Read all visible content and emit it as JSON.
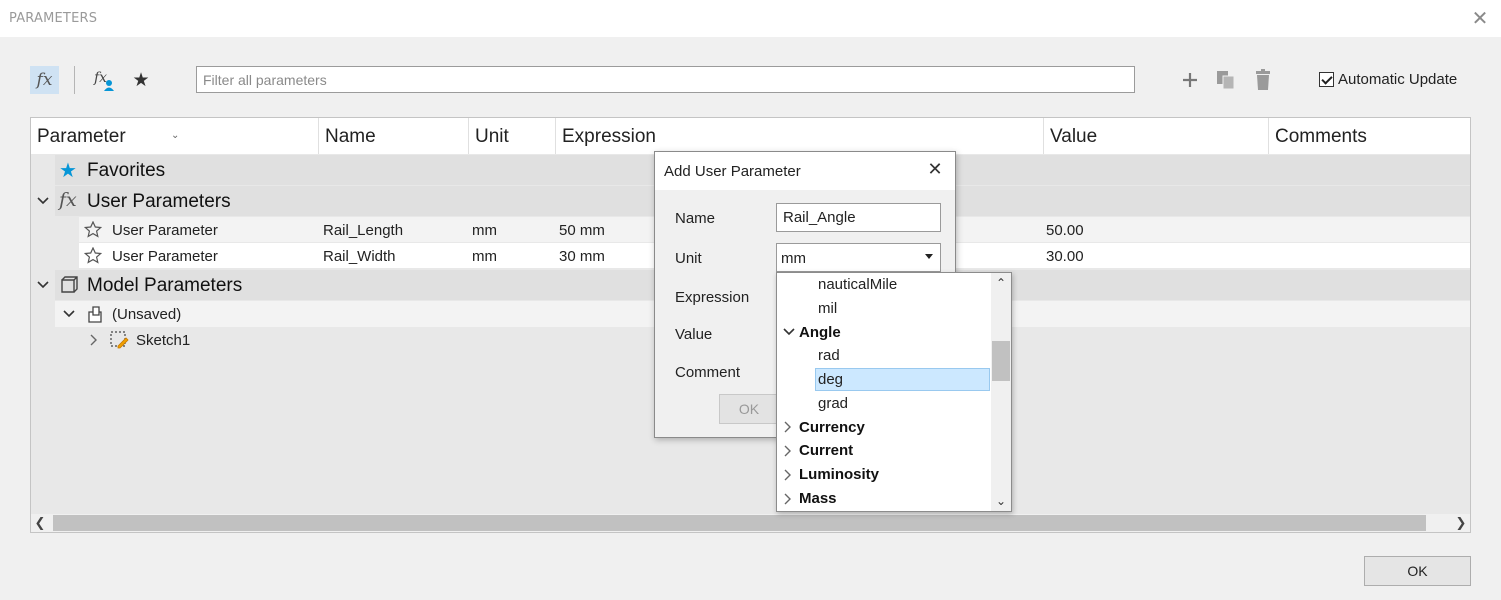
{
  "window": {
    "title": "PARAMETERS"
  },
  "toolbar": {
    "fx_label": "fx",
    "filter_placeholder": "Filter all parameters",
    "automatic_update_label": "Automatic Update",
    "automatic_update_checked": true
  },
  "table": {
    "columns": [
      "Parameter",
      "Name",
      "Unit",
      "Expression",
      "Value",
      "Comments"
    ],
    "groups": {
      "favorites": "Favorites",
      "user_parameters": "User Parameters",
      "model_parameters": "Model Parameters"
    },
    "user_rows": [
      {
        "parameter": "User Parameter",
        "name": "Rail_Length",
        "unit": "mm",
        "expression": "50 mm",
        "value": "50.00"
      },
      {
        "parameter": "User Parameter",
        "name": "Rail_Width",
        "unit": "mm",
        "expression": "30 mm",
        "value": "30.00"
      }
    ],
    "model_tree": {
      "component": "(Unsaved)",
      "sketch": "Sketch1"
    }
  },
  "add_dialog": {
    "title": "Add User Parameter",
    "name_label": "Name",
    "name_value": "Rail_Angle",
    "unit_label": "Unit",
    "unit_value": "mm",
    "expression_label": "Expression",
    "value_label": "Value",
    "comment_label": "Comment",
    "ok_label": "OK"
  },
  "unit_dropdown": {
    "items": [
      {
        "label": "nauticalMile",
        "kind": "unit"
      },
      {
        "label": "mil",
        "kind": "unit"
      },
      {
        "label": "Angle",
        "kind": "category",
        "expanded": true
      },
      {
        "label": "rad",
        "kind": "unit"
      },
      {
        "label": "deg",
        "kind": "unit",
        "selected": true
      },
      {
        "label": "grad",
        "kind": "unit"
      },
      {
        "label": "Currency",
        "kind": "category",
        "expanded": false
      },
      {
        "label": "Current",
        "kind": "category",
        "expanded": false
      },
      {
        "label": "Luminosity",
        "kind": "category",
        "expanded": false
      },
      {
        "label": "Mass",
        "kind": "category",
        "expanded": false
      }
    ]
  },
  "footer": {
    "ok_label": "OK"
  },
  "colors": {
    "accent": "#0696d7",
    "selection": "#cce8ff",
    "toolbar_active": "#cfe2f3"
  }
}
